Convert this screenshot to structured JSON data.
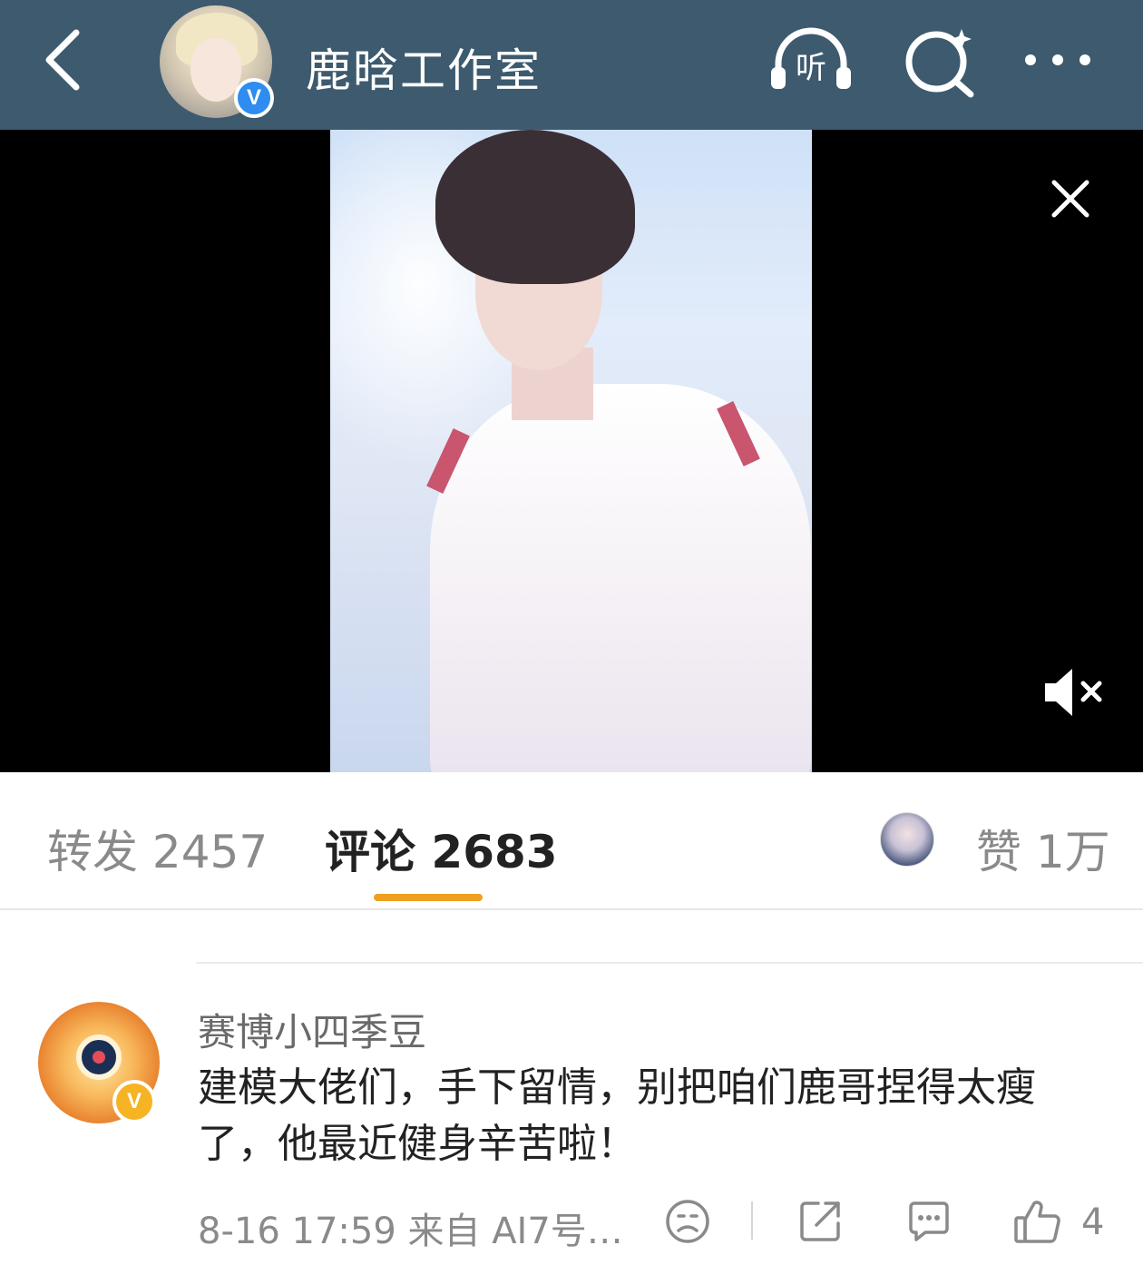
{
  "header": {
    "title": "鹿晗工作室",
    "verified_badge": "V",
    "listen_label": "听",
    "icons": [
      "back-icon",
      "listen-icon",
      "search-icon",
      "more-icon"
    ],
    "background": "#3d5a6e"
  },
  "video": {
    "icons": [
      "close-icon",
      "mute-icon"
    ]
  },
  "tabs": {
    "repost": "转发 2457",
    "comment": "评论 2683",
    "like": "赞 1万",
    "active_underline_color": "#f0a020"
  },
  "comment": {
    "username": "赛博小四季豆",
    "badge": "V",
    "text": "建模大佬们，手下留情，别把咱们鹿哥捏得太瘦了，他最近健身辛苦啦！",
    "meta": "8-16 17:59  来自 AI7号…",
    "like_count": "4",
    "icons": [
      "emoji-icon",
      "share-icon",
      "reply-icon",
      "thumbs-up-icon"
    ]
  }
}
